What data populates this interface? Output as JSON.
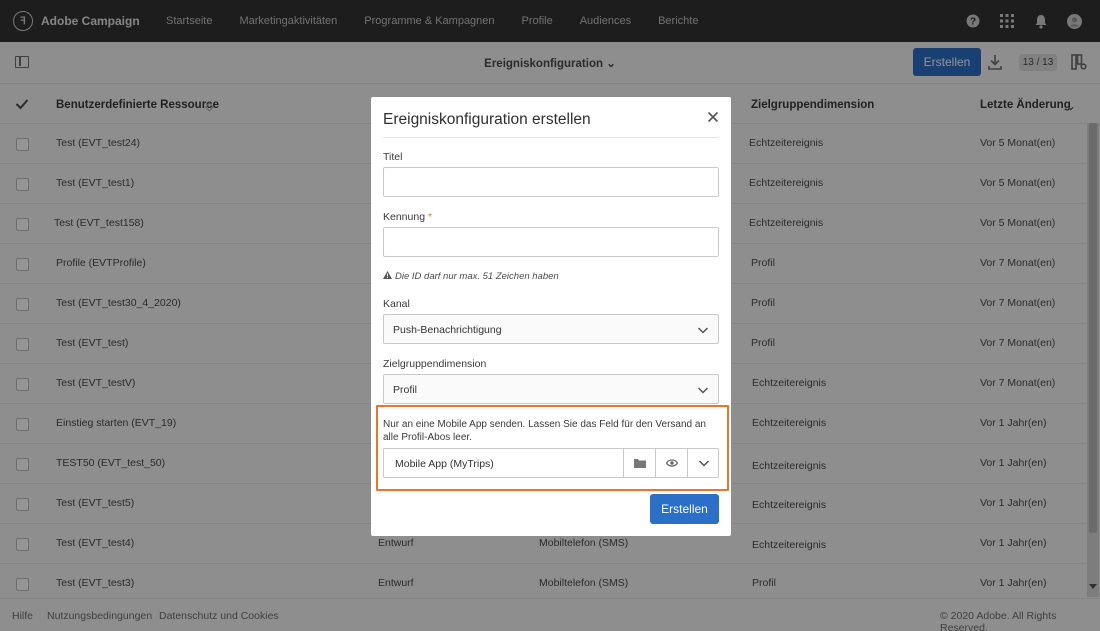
{
  "app": {
    "name": "Adobe Campaign",
    "logo_glyph": "ꟻ",
    "nav": [
      "Startseite",
      "Marketingaktivitäten",
      "Programme & Kampagnen",
      "Profile",
      "Audiences",
      "Berichte"
    ],
    "icons": [
      "help-icon",
      "apps-grid-icon",
      "bell-icon",
      "user-avatar-icon"
    ]
  },
  "toolbar": {
    "view_title": "Ereigniskonfiguration ⌄",
    "create_label": "Erstellen",
    "count": "13 / 13"
  },
  "table": {
    "headers": {
      "resource": "Benutzerdefinierte Ressource",
      "target": "Zielgruppendimension",
      "last_change": "Letzte Änderung"
    },
    "rows": [
      {
        "resource": "Test (EVT_test24)",
        "status": "",
        "channel": "",
        "target": "Echtzeitereignis",
        "last_change": "Vor 5 Monat(en)"
      },
      {
        "resource": "Test (EVT_test1)",
        "status": "",
        "channel": "",
        "target": "Echtzeitereignis",
        "last_change": "Vor 5 Monat(en)"
      },
      {
        "resource": "Test (EVT_test158)",
        "status": "",
        "channel": "",
        "target": "Echtzeitereignis",
        "last_change": "Vor 5 Monat(en)"
      },
      {
        "resource": "Profile (EVTProfile)",
        "status": "",
        "channel": "",
        "target": "Profil",
        "last_change": "Vor 7 Monat(en)"
      },
      {
        "resource": "Test (EVT_test30_4_2020)",
        "status": "",
        "channel": "",
        "target": "Profil",
        "last_change": "Vor 7 Monat(en)"
      },
      {
        "resource": "Test (EVT_test)",
        "status": "",
        "channel": "",
        "target": "Profil",
        "last_change": "Vor 7 Monat(en)"
      },
      {
        "resource": "Test (EVT_testV)",
        "status": "",
        "channel": "",
        "target": "Echtzeitereignis",
        "last_change": "Vor 7 Monat(en)"
      },
      {
        "resource": "Einstieg starten (EVT_19)",
        "status": "",
        "channel": "",
        "target": "Echtzeitereignis",
        "last_change": "Vor 1 Jahr(en)"
      },
      {
        "resource": "TEST50 (EVT_test_50)",
        "status": "",
        "channel": "",
        "target": "Echtzeitereignis",
        "last_change": "Vor 1 Jahr(en)"
      },
      {
        "resource": "Test (EVT_test5)",
        "status": "",
        "channel": "",
        "target": "Echtzeitereignis",
        "last_change": "Vor 1 Jahr(en)"
      },
      {
        "resource": "Test (EVT_test4)",
        "status": "Entwurf",
        "channel": "Mobiltelefon (SMS)",
        "target": "Echtzeitereignis",
        "last_change": "Vor 1 Jahr(en)"
      },
      {
        "resource": "Test (EVT_test3)",
        "status": "Entwurf",
        "channel": "Mobiltelefon (SMS)",
        "target": "Profil",
        "last_change": "Vor 1 Jahr(en)"
      }
    ]
  },
  "footer": {
    "links": [
      "Hilfe",
      "Nutzungsbedingungen",
      "Datenschutz und Cookies"
    ],
    "copyright": "© 2020 Adobe. All Rights Reserved."
  },
  "modal": {
    "title": "Ereigniskonfiguration erstellen",
    "title_field_label": "Titel",
    "title_value": "",
    "id_field_label": "Kennung",
    "id_required_marker": "*",
    "id_value": "",
    "id_hint": "Die ID darf nur max. 51 Zeichen haben",
    "channel_label": "Kanal",
    "channel_value": "Push-Benachrichtigung",
    "target_label": "Zielgruppendimension",
    "target_value": "Profil",
    "app_note": "Nur an eine Mobile App senden. Lassen Sie das Feld für den Versand an alle Profil-Abos leer.",
    "app_value": "Mobile App (MyTrips)",
    "create_label": "Erstellen"
  },
  "colors": {
    "accent": "#2c6fc6",
    "highlight": "#e8772e",
    "nav_bg": "#323232"
  }
}
